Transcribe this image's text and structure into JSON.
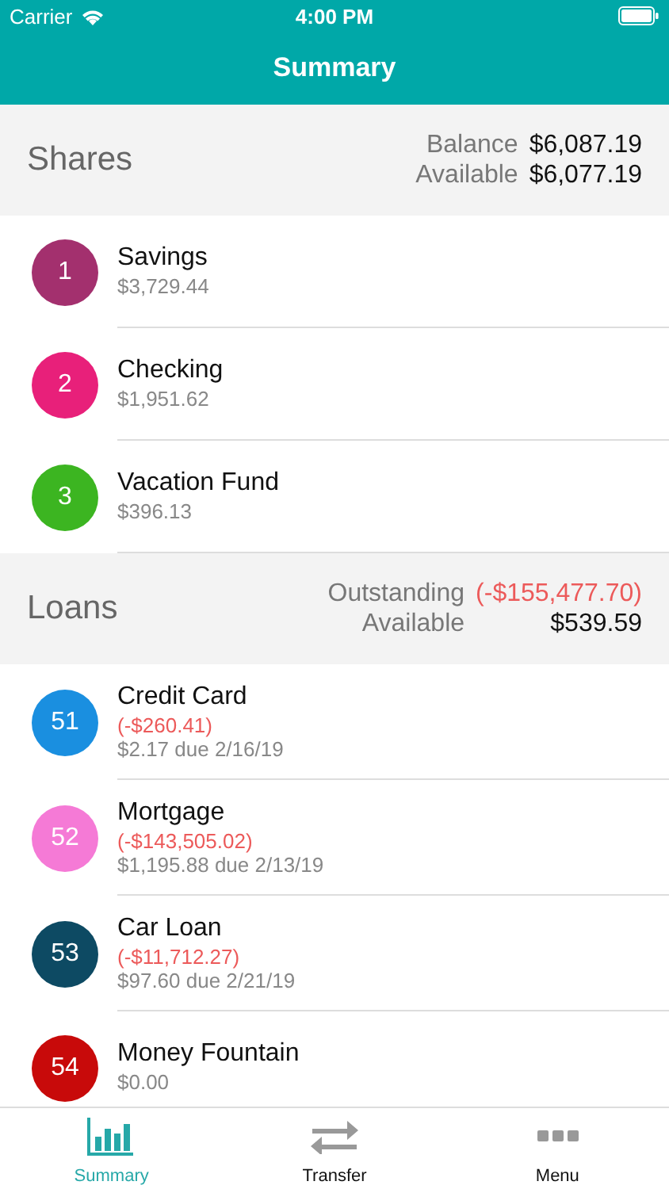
{
  "status_bar": {
    "carrier": "Carrier",
    "time": "4:00 PM"
  },
  "nav": {
    "title": "Summary"
  },
  "sections": [
    {
      "title": "Shares",
      "totals": [
        {
          "label": "Balance",
          "value": "$6,087.19",
          "negative": false
        },
        {
          "label": "Available",
          "value": "$6,077.19",
          "negative": false
        }
      ],
      "accounts": [
        {
          "number": "1",
          "color": "#a3306e",
          "name": "Savings",
          "lines": [
            {
              "text": "$3,729.44",
              "negative": false
            }
          ]
        },
        {
          "number": "2",
          "color": "#e8207a",
          "name": "Checking",
          "lines": [
            {
              "text": "$1,951.62",
              "negative": false
            }
          ]
        },
        {
          "number": "3",
          "color": "#3cb521",
          "name": "Vacation Fund",
          "lines": [
            {
              "text": "$396.13",
              "negative": false
            }
          ]
        }
      ]
    },
    {
      "title": "Loans",
      "totals": [
        {
          "label": "Outstanding",
          "value": "(-$155,477.70)",
          "negative": true
        },
        {
          "label": "Available",
          "value": "$539.59",
          "negative": false
        }
      ],
      "accounts": [
        {
          "number": "51",
          "color": "#1a8fe0",
          "name": "Credit Card",
          "lines": [
            {
              "text": "(-$260.41)",
              "negative": true
            },
            {
              "text": "$2.17 due 2/16/19",
              "negative": false
            }
          ]
        },
        {
          "number": "52",
          "color": "#f57ad6",
          "name": "Mortgage",
          "lines": [
            {
              "text": "(-$143,505.02)",
              "negative": true
            },
            {
              "text": "$1,195.88 due 2/13/19",
              "negative": false
            }
          ]
        },
        {
          "number": "53",
          "color": "#0d4a63",
          "name": "Car Loan",
          "lines": [
            {
              "text": "(-$11,712.27)",
              "negative": true
            },
            {
              "text": "$97.60 due 2/21/19",
              "negative": false
            }
          ]
        },
        {
          "number": "54",
          "color": "#c80a0a",
          "name": "Money Fountain",
          "lines": [
            {
              "text": "$0.00",
              "negative": false
            }
          ]
        }
      ]
    }
  ],
  "tabs": [
    {
      "kind": "chart",
      "label": "Summary",
      "selected": true
    },
    {
      "kind": "transfer",
      "label": "Transfer",
      "selected": false
    },
    {
      "kind": "more",
      "label": "Menu",
      "selected": false
    }
  ]
}
